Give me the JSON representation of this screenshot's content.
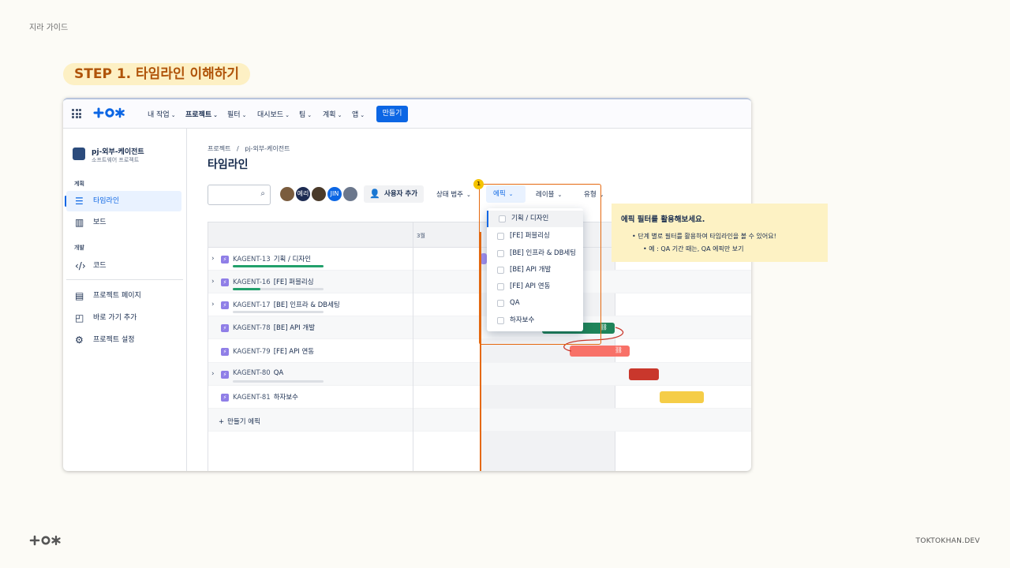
{
  "guide_title": "지라 가이드",
  "step_title": "STEP 1. 타임라인 이해하기",
  "footer_brand": "TOKTOKHAN.DEV",
  "nav": {
    "items": [
      {
        "label": "내 작업",
        "active": false
      },
      {
        "label": "프로젝트",
        "active": true
      },
      {
        "label": "필터",
        "active": false
      },
      {
        "label": "대시보드",
        "active": false
      },
      {
        "label": "팀",
        "active": false
      },
      {
        "label": "계획",
        "active": false
      },
      {
        "label": "앱",
        "active": false
      }
    ],
    "create_label": "만들기"
  },
  "sidebar": {
    "project_name": "pj-외부-케이전트",
    "project_type": "소프트웨어 프로젝트",
    "section_plan": "계획",
    "section_dev": "개발",
    "items": [
      {
        "label": "타임라인",
        "icon": "timeline-icon",
        "active": true
      },
      {
        "label": "보드",
        "icon": "board-icon",
        "active": false
      },
      {
        "label": "코드",
        "icon": "code-icon",
        "active": false
      },
      {
        "label": "프로젝트 페이지",
        "icon": "page-icon",
        "active": false
      },
      {
        "label": "바로 가기 추가",
        "icon": "add-shortcut-icon",
        "active": false
      },
      {
        "label": "프로젝트 설정",
        "icon": "gear-icon",
        "active": false
      }
    ]
  },
  "breadcrumb": {
    "root": "프로젝트",
    "sep": "/",
    "project": "pj-외부-케이전트"
  },
  "page_title": "타임라인",
  "toolbar": {
    "avatars": [
      {
        "label": "",
        "color": "#7a5c3e"
      },
      {
        "label": "예리",
        "color": "#1d2b52"
      },
      {
        "label": "",
        "color": "#4a3a2a"
      },
      {
        "label": "JIN",
        "color": "#0c66e4"
      },
      {
        "label": "",
        "color": "#6b778c"
      }
    ],
    "add_user": "사용자 추가",
    "filters": [
      "상태 범주",
      "에픽",
      "레이블",
      "유형"
    ]
  },
  "timeline": {
    "month": "3월",
    "rows": [
      {
        "key": "KAGENT-13",
        "title": "기획 / 디자인",
        "expandable": true,
        "progress": 1.0
      },
      {
        "key": "KAGENT-16",
        "title": "[FE] 퍼블리싱",
        "expandable": true,
        "progress": 0.3
      },
      {
        "key": "KAGENT-17",
        "title": "[BE] 인프라 & DB세팅",
        "expandable": true,
        "progress": 0.0
      },
      {
        "key": "KAGENT-78",
        "title": "[BE] API 개발",
        "expandable": false
      },
      {
        "key": "KAGENT-79",
        "title": "[FE] API 연동",
        "expandable": false
      },
      {
        "key": "KAGENT-80",
        "title": "QA",
        "expandable": true,
        "progress": 0.0
      },
      {
        "key": "KAGENT-81",
        "title": "하자보수",
        "expandable": false
      }
    ],
    "create_epic": "만들기 에픽"
  },
  "epic_dropdown": {
    "badge": "1",
    "options": [
      "기획 / 디자인",
      "[FE] 퍼블리싱",
      "[BE] 인프라 & DB세팅",
      "[BE] API 개발",
      "[FE] API 연동",
      "QA",
      "하자보수"
    ]
  },
  "tip": {
    "title": "에픽 필터를 활용해보세요.",
    "line1": "•  단계 별로 필터를 활용하여 타임라인을 볼 수 있어요!",
    "line2": "•  예 : QA 기간 때는, QA 에픽만 보기"
  },
  "colors": {
    "accent": "#0c66e4",
    "highlight": "#e56910",
    "bar_green": "#1f845a",
    "bar_red_light": "#f87168",
    "bar_red": "#c9372c",
    "bar_yellow": "#f5cd47"
  }
}
